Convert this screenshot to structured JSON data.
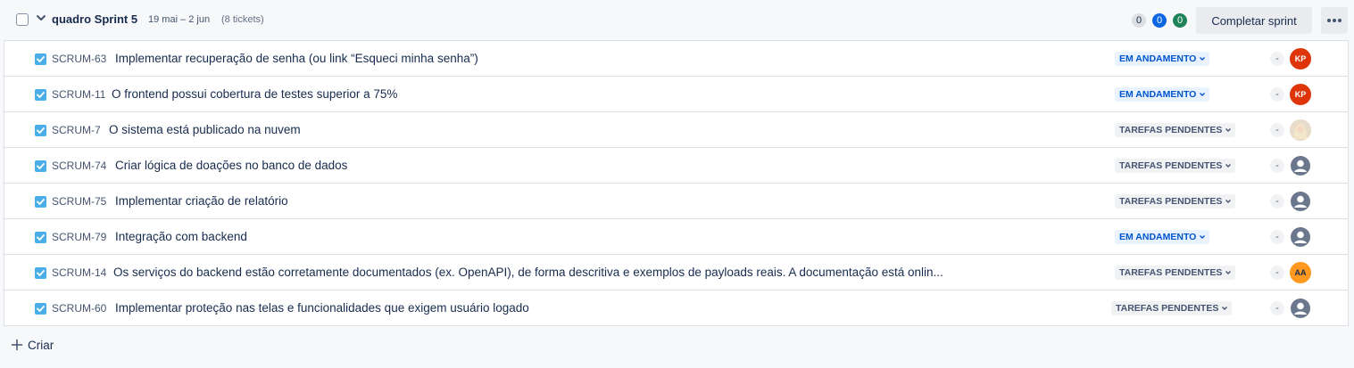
{
  "sprint": {
    "name": "quadro Sprint 5",
    "dates": "19 mai – 2 jun",
    "ticket_count": "(8 tickets)",
    "counts": {
      "todo": "0",
      "in_progress": "0",
      "done": "0"
    },
    "complete_label": "Completar sprint"
  },
  "issues": [
    {
      "key": "SCRUM-63",
      "summary": "Implementar recuperação de senha (ou link “Esqueci minha senha”)",
      "status": "EM ANDAMENTO",
      "estimate": "-",
      "assignee": "KP"
    },
    {
      "key": "SCRUM-11",
      "summary": "O frontend possui cobertura de testes superior a 75%",
      "status": "EM ANDAMENTO",
      "estimate": "-",
      "assignee": "KP"
    },
    {
      "key": "SCRUM-7",
      "summary": "O sistema está publicado na nuvem",
      "status": "TAREFAS PENDENTES",
      "estimate": "-",
      "assignee": ""
    },
    {
      "key": "SCRUM-74",
      "summary": "Criar lógica de doações no banco de dados",
      "status": "TAREFAS PENDENTES",
      "estimate": "-",
      "assignee": ""
    },
    {
      "key": "SCRUM-75",
      "summary": "Implementar criação de relatório",
      "status": "TAREFAS PENDENTES",
      "estimate": "-",
      "assignee": ""
    },
    {
      "key": "SCRUM-79",
      "summary": "Integração com backend",
      "status": "EM ANDAMENTO",
      "estimate": "-",
      "assignee": ""
    },
    {
      "key": "SCRUM-14",
      "summary": "Os serviços do backend estão corretamente documentados (ex. OpenAPI), de forma descritiva e exemplos de payloads reais. A documentação está onlin...",
      "status": "TAREFAS PENDENTES",
      "estimate": "-",
      "assignee": "AA"
    },
    {
      "key": "SCRUM-60",
      "summary": "Implementar proteção nas telas e funcionalidades que exigem usuário logado",
      "status": "TAREFAS PENDENTES",
      "estimate": "-",
      "assignee": ""
    }
  ],
  "create_label": "Criar",
  "colors": {
    "story_icon": "#4bade8",
    "in_progress_bg": "#e9f2ff",
    "in_progress_text": "#0055cc",
    "pending_bg": "#f1f2f4",
    "pending_text": "#44546f",
    "avatar_kp": "#de350b",
    "avatar_aa": "#ff991f"
  }
}
